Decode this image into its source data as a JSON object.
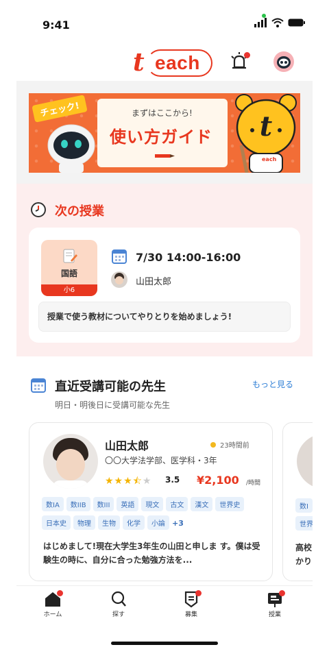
{
  "status": {
    "time": "9:41"
  },
  "header": {
    "logo": "each"
  },
  "banner": {
    "tag": "チェック!",
    "subtitle": "まずはここから!",
    "title": "使い方ガイド",
    "mascot_badge": "each"
  },
  "next_lesson": {
    "section_title": "次の授業",
    "subject": "国語",
    "grade": "小6",
    "datetime": "7/30 14:00-16:00",
    "teacher": "山田太郎",
    "message": "授業で使う教材についてやりとりを始めましょう!"
  },
  "teachers": {
    "section_title": "直近受講可能の先生",
    "subtitle": "明日・明後日に受講可能な先生",
    "more_label": "もっと見る",
    "cards": [
      {
        "name": "山田太郎",
        "last_active": "23時間前",
        "school": "〇〇大学法学部、医学科・3年",
        "rating": "3.5",
        "stars": "★★★★★",
        "price": "¥2,100",
        "price_unit": "/時間",
        "tags": [
          "数IA",
          "数IIB",
          "数III",
          "英語",
          "現文",
          "古文",
          "漢文",
          "世界史",
          "日本史",
          "物理",
          "生物",
          "化学",
          "小論"
        ],
        "tags_more": "+3",
        "intro": "はじめまして!現在大学生3年生の山田と申しま す。僕は受験生の時に、自分に合った勉強方法を..."
      }
    ],
    "peek_card": {
      "tags": [
        "数I",
        "世界"
      ],
      "intro": "高校 かり"
    }
  },
  "tabs": [
    {
      "label": "ホーム",
      "icon": "home-icon"
    },
    {
      "label": "探す",
      "icon": "search-icon"
    },
    {
      "label": "募集",
      "icon": "recruit-icon"
    },
    {
      "label": "授業",
      "icon": "lesson-icon"
    }
  ],
  "colors": {
    "accent": "#e8371f",
    "link": "#2f7fd6",
    "tag_bg": "#e8f1fb"
  }
}
